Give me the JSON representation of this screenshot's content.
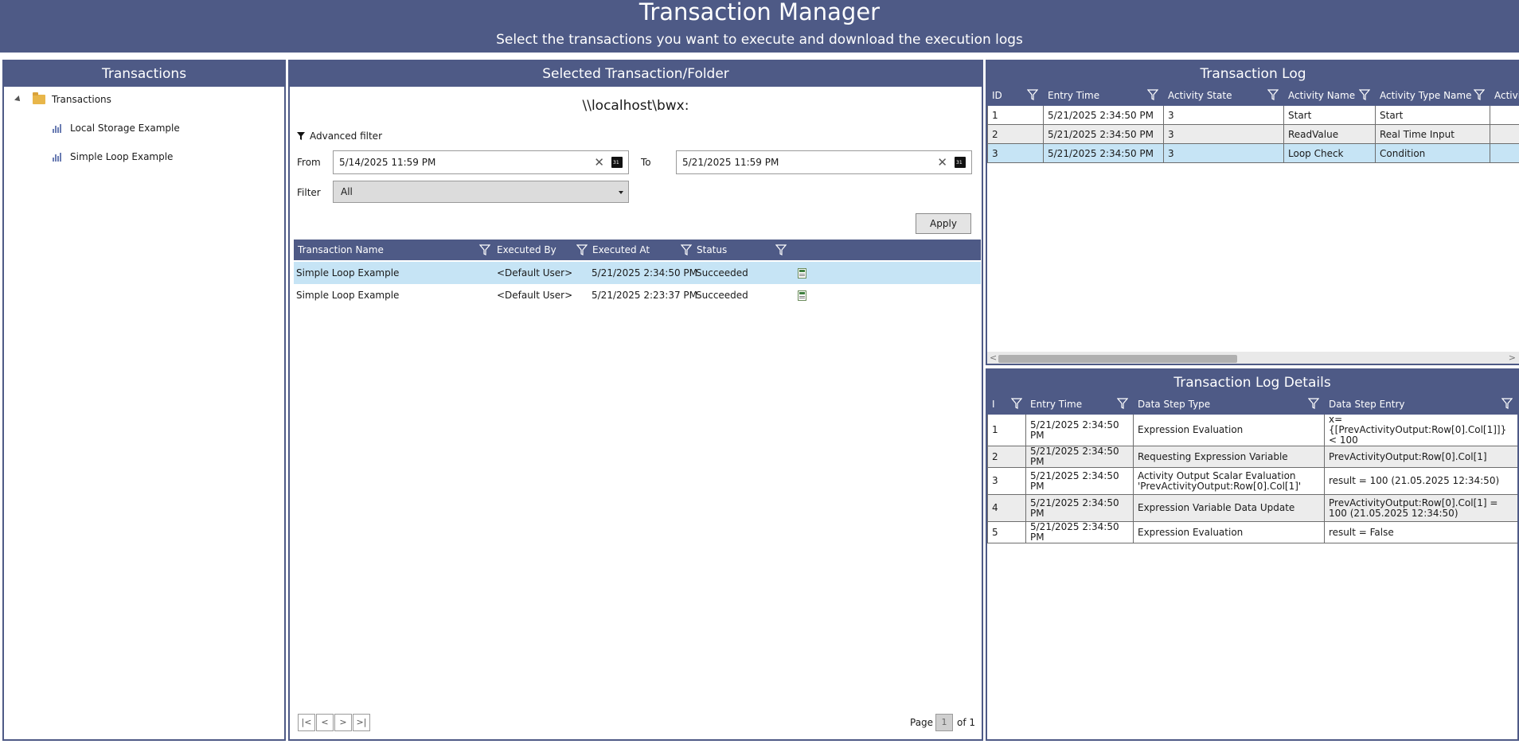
{
  "header": {
    "title": "Transaction Manager",
    "subtitle": "Select the transactions you want to execute and download the execution logs"
  },
  "transactions_panel": {
    "title": "Transactions",
    "root_label": "Transactions",
    "items": [
      {
        "label": "Local Storage Example"
      },
      {
        "label": "Simple Loop Example"
      }
    ]
  },
  "selected_panel": {
    "title": "Selected Transaction/Folder",
    "path": "\\\\localhost\\bwx:",
    "advanced_filter_label": "Advanced filter",
    "from_label": "From",
    "from_value": "5/14/2025 11:59 PM",
    "to_label": "To",
    "to_value": "5/21/2025 11:59 PM",
    "filter_label": "Filter",
    "filter_value": "All",
    "apply_label": "Apply",
    "columns": [
      "Transaction Name",
      "Executed By",
      "Executed At",
      "Status"
    ],
    "rows": [
      {
        "name": "Simple Loop Example",
        "executed_by": "<Default User>",
        "executed_at": "5/21/2025 2:34:50 PM",
        "status": "Succeeded",
        "selected": true
      },
      {
        "name": "Simple Loop Example",
        "executed_by": "<Default User>",
        "executed_at": "5/21/2025 2:23:37 PM",
        "status": "Succeeded",
        "selected": false
      }
    ],
    "pager": {
      "page_label": "Page",
      "current": "1",
      "of_label": "of 1"
    }
  },
  "log_panel": {
    "title": "Transaction Log",
    "columns": [
      "ID",
      "Entry Time",
      "Activity State",
      "Activity Name",
      "Activity Type Name",
      "Activi"
    ],
    "rows": [
      {
        "id": "1",
        "time": "5/21/2025 2:34:50 PM",
        "state": "3",
        "name": "Start",
        "type": "Start"
      },
      {
        "id": "2",
        "time": "5/21/2025 2:34:50 PM",
        "state": "3",
        "name": "ReadValue",
        "type": "Real Time Input"
      },
      {
        "id": "3",
        "time": "5/21/2025 2:34:50 PM",
        "state": "3",
        "name": "Loop Check",
        "type": "Condition"
      }
    ]
  },
  "details_panel": {
    "title": "Transaction Log Details",
    "columns": [
      "I",
      "Entry Time",
      "Data Step Type",
      "Data Step Entry"
    ],
    "rows": [
      {
        "i": "1",
        "time": "5/21/2025 2:34:50 PM",
        "type": "Expression Evaluation",
        "entry": "x={[PrevActivityOutput:Row[0].Col[1]]} < 100"
      },
      {
        "i": "2",
        "time": "5/21/2025 2:34:50 PM",
        "type": "Requesting Expression Variable",
        "entry": "PrevActivityOutput:Row[0].Col[1]"
      },
      {
        "i": "3",
        "time": "5/21/2025 2:34:50 PM",
        "type": "Activity Output Scalar Evaluation 'PrevActivityOutput:Row[0].Col[1]'",
        "entry": "result = 100 (21.05.2025 12:34:50)"
      },
      {
        "i": "4",
        "time": "5/21/2025 2:34:50 PM",
        "type": "Expression Variable Data Update",
        "entry": "PrevActivityOutput:Row[0].Col[1] = 100 (21.05.2025 12:34:50)"
      },
      {
        "i": "5",
        "time": "5/21/2025 2:34:50 PM",
        "type": "Expression Evaluation",
        "entry": "result = False"
      }
    ]
  },
  "icons": {
    "filter": "funnel-icon",
    "calendar": "calendar-icon",
    "clear": "clear-icon",
    "folder": "folder-icon",
    "transaction": "transaction-icon",
    "log": "log-file-icon"
  },
  "colors": {
    "header": "#4e5a86",
    "selection": "#c6e4f5"
  }
}
